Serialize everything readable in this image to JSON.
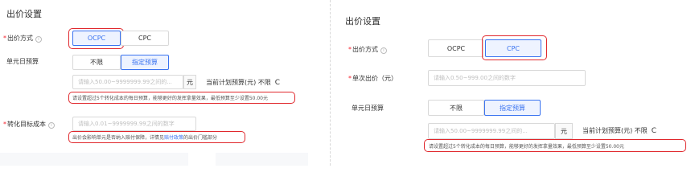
{
  "left": {
    "title": "出价设置",
    "bid_method": {
      "label": "出价方式",
      "options": [
        "OCPC",
        "CPC"
      ]
    },
    "daily_budget": {
      "label": "单元日预算",
      "options": [
        "不限",
        "指定预算"
      ],
      "placeholder": "请输入50.00~9999999.99之间的...",
      "unit": "元",
      "current_label": "当前计划预算(元) 不限",
      "refresh_icon": "C",
      "hint": "请设置超过5个转化成本的每日预算，能够更好的发挥拿量效果，最低预算至少设置50.00元"
    },
    "target_cost": {
      "label": "转化目标成本",
      "placeholder": "请输入0.01~9999999.99之间的数字",
      "hint_pre": "出价会影响单元是否纳入赔付保障，详情见",
      "hint_link": "赔付政策",
      "hint_post": "的出价门槛部分"
    }
  },
  "right": {
    "title": "出价设置",
    "bid_method": {
      "label": "出价方式",
      "options": [
        "OCPC",
        "CPC"
      ]
    },
    "single_bid": {
      "label": "单次出价（元）",
      "placeholder": "请输入0.50~999.00之间的数字"
    },
    "daily_budget": {
      "label": "单元日预算",
      "options": [
        "不限",
        "指定预算"
      ],
      "placeholder": "请输入50.00~9999999.99之间的...",
      "unit": "元",
      "current_label": "当前计划预算(元) 不限",
      "refresh_icon": "C",
      "hint": "请设置超过5个转化成本的每日预算，能够更好的发挥拿量效果，最低预算至少设置50.00元"
    }
  },
  "colors": {
    "accent": "#3a73f0",
    "highlight": "#e0282d",
    "required": "#f5222d"
  }
}
